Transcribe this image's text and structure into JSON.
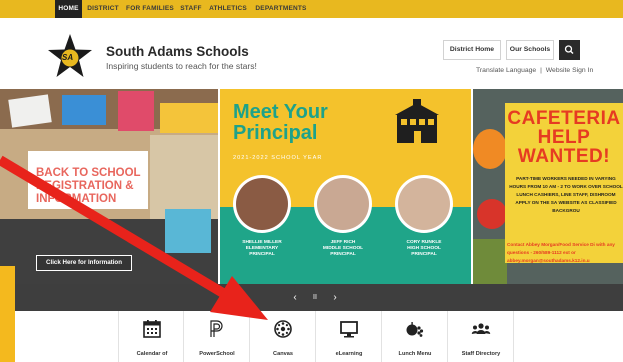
{
  "nav": {
    "items": [
      "HOME",
      "DISTRICT",
      "FOR FAMILIES",
      "STAFF",
      "ATHLETICS",
      "DEPARTMENTS"
    ]
  },
  "header": {
    "logo_text": "SA",
    "title": "South Adams Schools",
    "tagline": "Inspiring students to reach for the stars!",
    "district_home": "District Home",
    "our_schools": "Our Schools",
    "translate": "Translate Language",
    "separator": "|",
    "website_signin": "Website Sign In"
  },
  "slides": {
    "left": {
      "headline": "BACK TO SCHOOL REGISTRATION & INFORMATION",
      "button": "Click Here for Information"
    },
    "center": {
      "title_line1": "Meet Your",
      "title_line2": "Principal",
      "subtitle": "2021-2022 SCHOOL YEAR",
      "principals": [
        {
          "name": "SHELLIE MILLER",
          "school": "ELEMENTARY",
          "role": "PRINCIPAL"
        },
        {
          "name": "JEFF RICH",
          "school": "MIDDLE SCHOOL",
          "role": "PRINCIPAL"
        },
        {
          "name": "CORY RUNKLE",
          "school": "HIGH SCHOOL",
          "role": "PRINCIPAL"
        }
      ]
    },
    "right": {
      "title": "CAFETERIA HELP WANTED!",
      "title_line1": "CAFETERIA",
      "title_line2": "HELP",
      "title_line3": "WANTED!",
      "body": "PART-TIME WORKERS NEEDED IN VARYING HOURS FROM 10 AM - 2 TO WORK OVER SCHOOL LUNCH CASHIERS, LINE STAFF, DISHROOM APPLY ON THE SA WEBSITE AS CLASSIFIED BACKGROU",
      "contact": "Contact Abbey Morgan/Food Service Di with any questions - 260/589-1112 ext or abbey.morgan@southadams.k12.in.u"
    },
    "controls": {
      "prev": "‹",
      "pause": "II",
      "next": "›"
    }
  },
  "quick_links": [
    {
      "label": "Calendar of",
      "icon": "calendar-icon"
    },
    {
      "label": "PowerSchool",
      "icon": "powerschool-icon"
    },
    {
      "label": "Canvas",
      "icon": "canvas-icon"
    },
    {
      "label": "eLearning",
      "icon": "monitor-icon"
    },
    {
      "label": "Lunch Menu",
      "icon": "apple-icon"
    },
    {
      "label": "Staff Directory",
      "icon": "people-icon"
    }
  ],
  "colors": {
    "nav_bar": "#e8b81f",
    "accent_green": "#1fa589",
    "annotation_arrow": "#e8231b"
  }
}
